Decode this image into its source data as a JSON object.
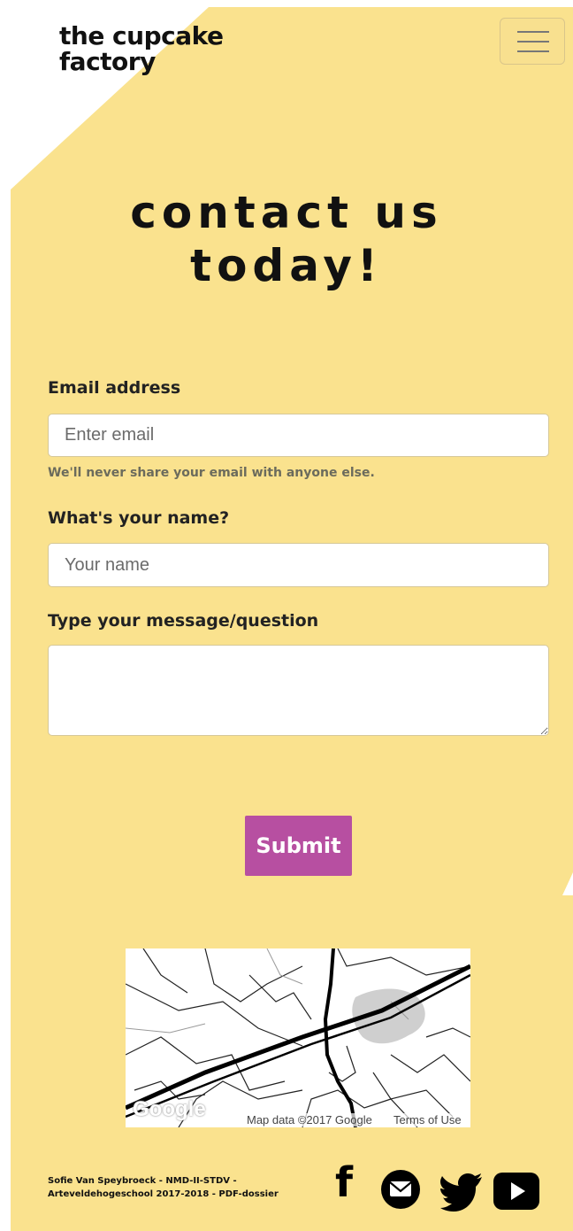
{
  "header": {
    "logo_line1": "the cupcake",
    "logo_line2": "factory",
    "menu_icon": "hamburger-icon"
  },
  "page": {
    "heading_line1": "contact us",
    "heading_line2": "today!"
  },
  "form": {
    "email_label": "Email address",
    "email_placeholder": "Enter email",
    "email_value": "",
    "email_help": "We'll never share your email with anyone else.",
    "name_label": "What's your name?",
    "name_placeholder": "Your name",
    "name_value": "",
    "message_label": "Type your message/question",
    "message_value": "",
    "submit_label": "Submit"
  },
  "map": {
    "logo_text": "Google",
    "attribution": "Map data ©2017 Google",
    "terms": "Terms of Use"
  },
  "footer": {
    "credit_line1": "Sofie Van Speybroeck - NMD-II-STDV -",
    "credit_line2": "Arteveldehogeschool 2017-2018 - PDF-dossier",
    "social": [
      "facebook-icon",
      "email-icon",
      "twitter-icon",
      "youtube-icon"
    ]
  },
  "colors": {
    "background_yellow": "#fae28e",
    "submit_purple": "#b74fa1",
    "page_white": "#ffffff"
  }
}
